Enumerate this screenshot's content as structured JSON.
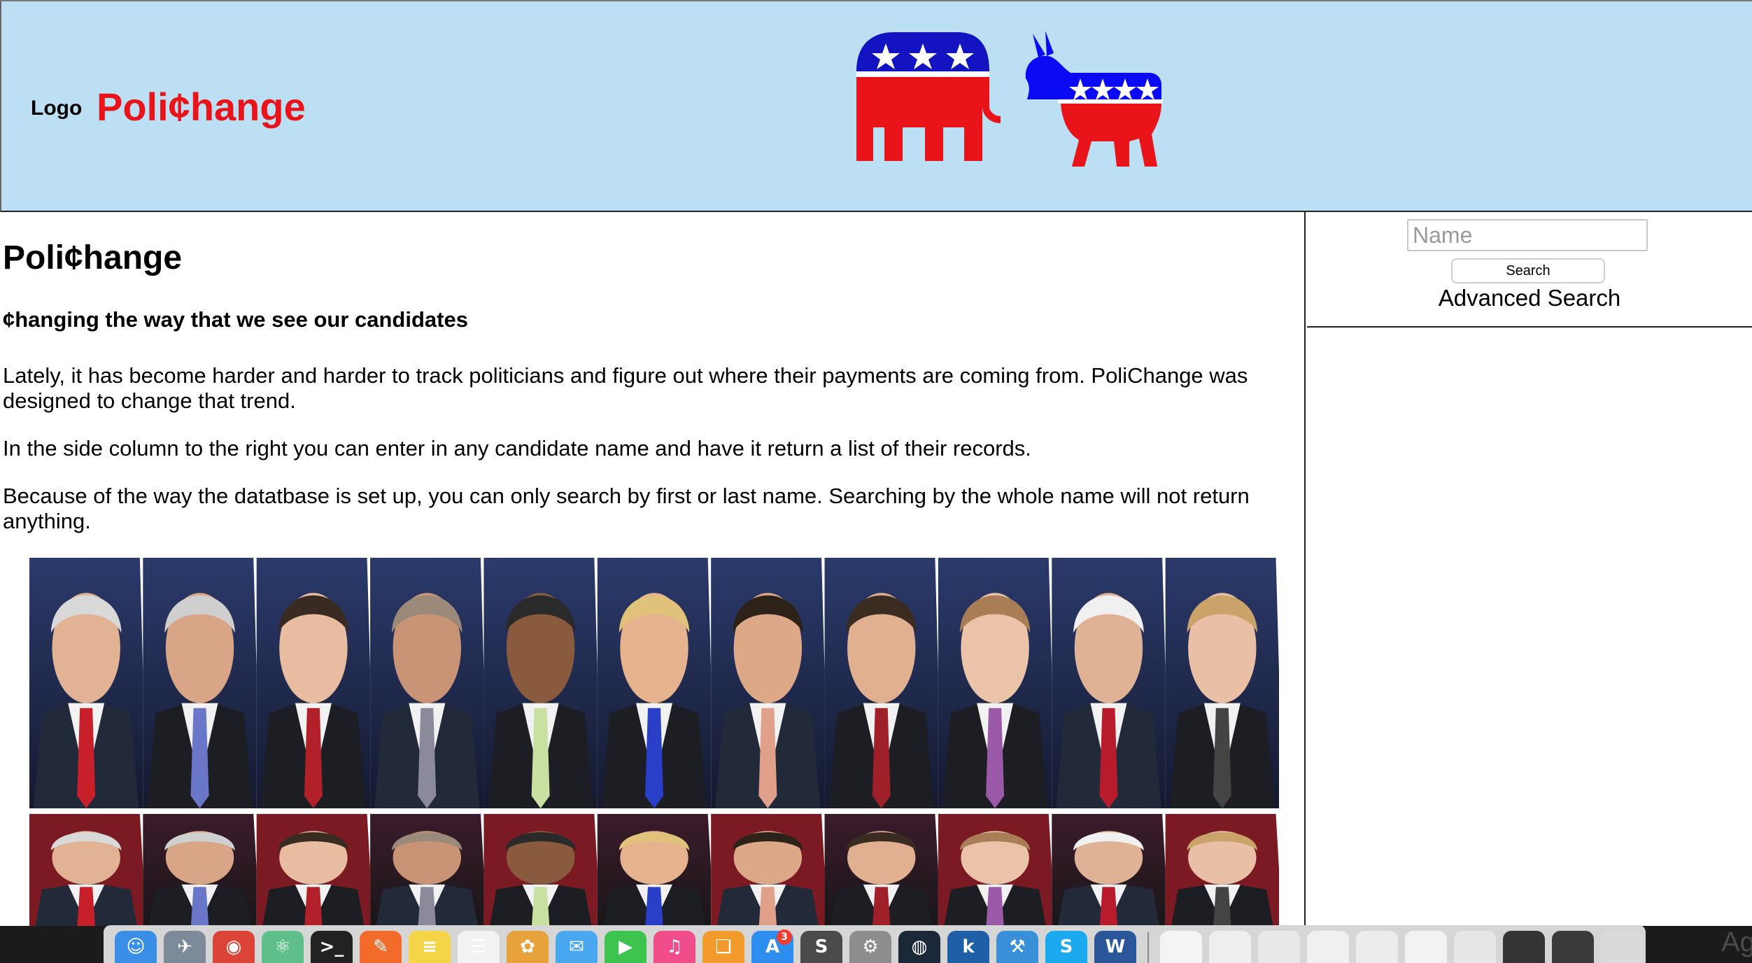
{
  "header": {
    "logo_label": "Logo",
    "brand": "Poli¢hange",
    "colors": {
      "background": "#bcdff4",
      "brand_red": "#e8141a",
      "elephant_blue": "#1313c2",
      "donkey_blue": "#0a0af5"
    },
    "party_icons": [
      "republican-elephant-icon",
      "democratic-donkey-icon"
    ]
  },
  "main": {
    "title": "Poli¢hange",
    "tagline": "¢hanging the way that we see our candidates",
    "paragraphs": [
      "Lately, it has become harder and harder to track politicians and figure out where their payments are coming from. PoliChange was designed to change that trend.",
      "In the side column to the right you can enter in any candidate name and have it return a list of their records.",
      "Because of the way the datatbase is set up, you can only search by first or last name. Searching by the whole name will not return anything."
    ]
  },
  "sidebar": {
    "name_placeholder": "Name",
    "name_value": "",
    "search_label": "Search",
    "advanced_search_label": "Advanced Search"
  },
  "dock": {
    "apps": [
      {
        "icon": "finder-icon",
        "color": "#3b8ee6",
        "glyph": "☺"
      },
      {
        "icon": "launchpad-icon",
        "color": "#7d8a99",
        "glyph": "✈"
      },
      {
        "icon": "chrome-icon",
        "color": "#dc4437",
        "glyph": "◉"
      },
      {
        "icon": "atom-icon",
        "color": "#5ebf8a",
        "glyph": "⚛"
      },
      {
        "icon": "terminal-icon",
        "color": "#222222",
        "glyph": ">_"
      },
      {
        "icon": "pencil-app-icon",
        "color": "#f26b2a",
        "glyph": "✎"
      },
      {
        "icon": "notes-icon",
        "color": "#f5d548",
        "glyph": "≡"
      },
      {
        "icon": "reminders-icon",
        "color": "#f2f2f2",
        "glyph": "☰"
      },
      {
        "icon": "photos-icon",
        "color": "#e7a23b",
        "glyph": "✿"
      },
      {
        "icon": "messages-icon",
        "color": "#4aa8f0",
        "glyph": "✉"
      },
      {
        "icon": "facetime-icon",
        "color": "#3dc44f",
        "glyph": "▶"
      },
      {
        "icon": "itunes-icon",
        "color": "#f04d8a",
        "glyph": "♫"
      },
      {
        "icon": "ibooks-icon",
        "color": "#f39a2d",
        "glyph": "❑"
      },
      {
        "icon": "app-store-icon",
        "color": "#2d8ef0",
        "glyph": "A",
        "badge": "3"
      },
      {
        "icon": "sublime-icon",
        "color": "#4b4b4b",
        "glyph": "S"
      },
      {
        "icon": "system-preferences-icon",
        "color": "#8d8d8d",
        "glyph": "⚙"
      },
      {
        "icon": "steam-icon",
        "color": "#1b2838",
        "glyph": "◍"
      },
      {
        "icon": "kindle-icon",
        "color": "#1f5fa8",
        "glyph": "k"
      },
      {
        "icon": "xcode-icon",
        "color": "#3a8fd9",
        "glyph": "⚒"
      },
      {
        "icon": "skype-icon",
        "color": "#1ba9f0",
        "glyph": "S"
      },
      {
        "icon": "word-icon",
        "color": "#2b579a",
        "glyph": "W"
      }
    ],
    "files": [
      {
        "icon": "document-icon",
        "color": "#f4f4f4"
      },
      {
        "icon": "document-icon",
        "color": "#eeeeee"
      },
      {
        "icon": "document-icon",
        "color": "#e8e8e8"
      },
      {
        "icon": "document-icon",
        "color": "#f0f0f0"
      },
      {
        "icon": "document-icon",
        "color": "#ececec"
      },
      {
        "icon": "document-icon",
        "color": "#f2f2f2"
      },
      {
        "icon": "document-icon",
        "color": "#e6e6e6"
      },
      {
        "icon": "terminal-window-icon",
        "color": "#333333"
      },
      {
        "icon": "screen-window-icon",
        "color": "#3a3a3a"
      },
      {
        "icon": "trash-icon",
        "color": "#dadada"
      }
    ],
    "corner_text": "Ag"
  }
}
